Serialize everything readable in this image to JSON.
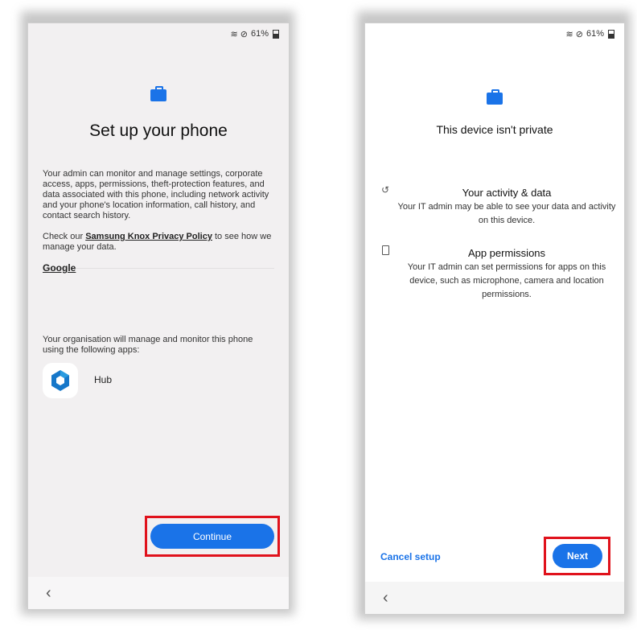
{
  "status_bar": {
    "signal": "≋",
    "dnd": "⊘",
    "battery": "61%"
  },
  "screen1": {
    "title": "Set up your phone",
    "description": "Your admin can monitor and manage settings, corporate access, apps, permissions, theft-protection features, and data associated with this phone, including network activity and your phone's location information, call history, and contact search history.",
    "privacy_prefix": "Check our ",
    "privacy_link": "Samsung Knox Privacy Policy",
    "privacy_suffix": " to see how we manage your data.",
    "google_link": "Google",
    "apps_intro": "Your organisation will manage and monitor this phone using the following apps:",
    "app_name": "Hub",
    "continue_label": "Continue",
    "back_glyph": "‹"
  },
  "screen2": {
    "title": "This device isn't private",
    "section1_title": "Your activity & data",
    "section1_desc": "Your IT admin may be able to see your data and activity on this device.",
    "section2_title": "App permissions",
    "section2_desc": "Your IT admin can set permissions for apps on this device, such as microphone, camera and location permissions.",
    "cancel_label": "Cancel setup",
    "next_label": "Next",
    "back_glyph": "‹"
  },
  "colors": {
    "accent": "#1a73e8",
    "highlight": "#e0121c",
    "hub_icon": "#1677c9"
  },
  "icons": {
    "section1": "history-icon",
    "section2": "device-info-icon",
    "header": "briefcase-icon"
  }
}
